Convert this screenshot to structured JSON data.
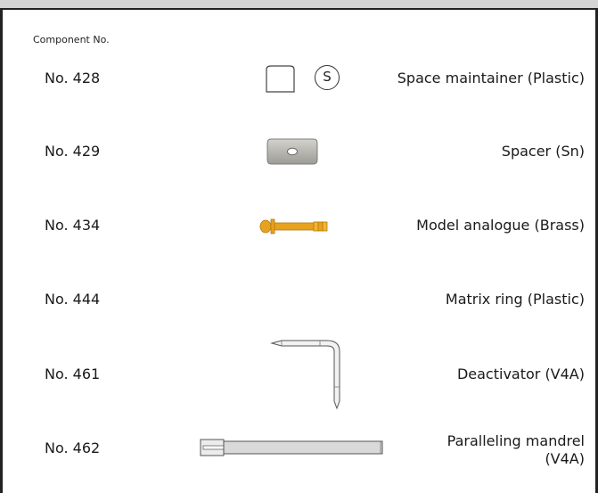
{
  "header": {
    "label": "Component No."
  },
  "components": [
    {
      "number": "No. 428",
      "description": "Space maintainer (Plastic)",
      "icon": "space-maintainer-icon",
      "badge": "S"
    },
    {
      "number": "No. 429",
      "description": "Spacer (Sn)",
      "icon": "spacer-icon"
    },
    {
      "number": "No. 434",
      "description": "Model analogue (Brass)",
      "icon": "model-analogue-icon"
    },
    {
      "number": "No. 444",
      "description": "Matrix ring (Plastic)",
      "icon": ""
    },
    {
      "number": "No. 461",
      "description": "Deactivator (V4A)",
      "icon": "deactivator-icon"
    },
    {
      "number": "No. 462",
      "description_lines": [
        "Paralleling mandrel",
        "(V4A)"
      ],
      "icon": "paralleling-mandrel-icon"
    }
  ],
  "colors": {
    "brass": "#e7a21e",
    "tin": "#b7b6b0",
    "frame": "#222222",
    "topbar": "#d4d4d4"
  }
}
